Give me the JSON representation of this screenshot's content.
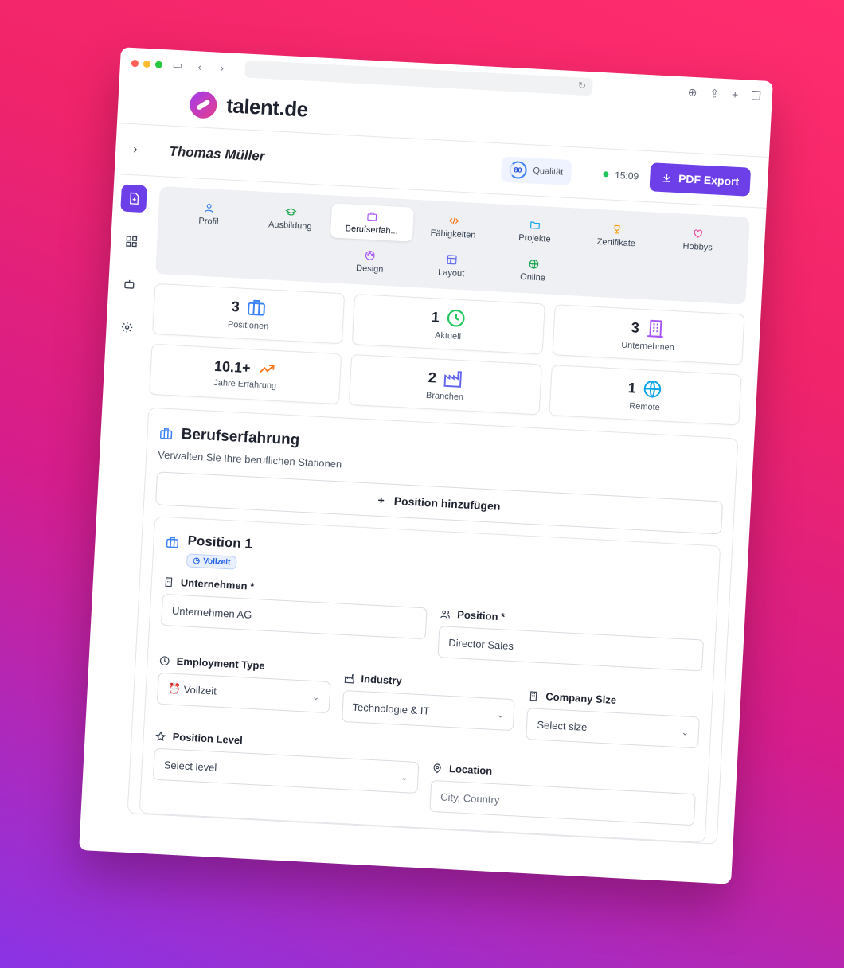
{
  "brand": {
    "name": "talent.de"
  },
  "header": {
    "user_name": "Thomas Müller",
    "quality_score": "80",
    "quality_label": "Qualität",
    "time": "15:09",
    "pdf_button": "PDF Export"
  },
  "tabs": [
    {
      "label": "Profil",
      "icon": "user-icon"
    },
    {
      "label": "Ausbildung",
      "icon": "graduation-cap-icon"
    },
    {
      "label": "Berufserfah...",
      "icon": "briefcase-icon",
      "active": true
    },
    {
      "label": "Fähigkeiten",
      "icon": "code-icon"
    },
    {
      "label": "Projekte",
      "icon": "folder-icon"
    },
    {
      "label": "Zertifikate",
      "icon": "trophy-icon"
    },
    {
      "label": "Hobbys",
      "icon": "heart-icon"
    },
    {
      "label": "Design",
      "icon": "palette-icon"
    },
    {
      "label": "Layout",
      "icon": "layout-icon"
    },
    {
      "label": "Online",
      "icon": "globe-icon"
    }
  ],
  "stats": [
    {
      "value": "3",
      "label": "Positionen",
      "icon": "briefcase-icon",
      "color": "#3b82f6"
    },
    {
      "value": "1",
      "label": "Aktuell",
      "icon": "clock-icon",
      "color": "#22c55e"
    },
    {
      "value": "3",
      "label": "Unternehmen",
      "icon": "building-icon",
      "color": "#a855f7"
    },
    {
      "value": "10.1+",
      "label": "Jahre Erfahrung",
      "icon": "trending-up-icon",
      "color": "#f97316"
    },
    {
      "value": "2",
      "label": "Branchen",
      "icon": "factory-icon",
      "color": "#6366f1"
    },
    {
      "value": "1",
      "label": "Remote",
      "icon": "globe-icon",
      "color": "#0ea5e9"
    }
  ],
  "section": {
    "title": "Berufserfahrung",
    "subtitle": "Verwalten Sie Ihre beruflichen Stationen",
    "add_button": "Position hinzufügen"
  },
  "position": {
    "title": "Position 1",
    "badge": "Vollzeit",
    "company_label": "Unternehmen *",
    "company_value": "Unternehmen AG",
    "position_label": "Position *",
    "position_value": "Director Sales",
    "employment_label": "Employment Type",
    "employment_value": "Vollzeit",
    "industry_label": "Industry",
    "industry_value": "Technologie & IT",
    "company_size_label": "Company Size",
    "company_size_placeholder": "Select size",
    "level_label": "Position Level",
    "level_placeholder": "Select level",
    "location_label": "Location",
    "location_placeholder": "City, Country"
  }
}
